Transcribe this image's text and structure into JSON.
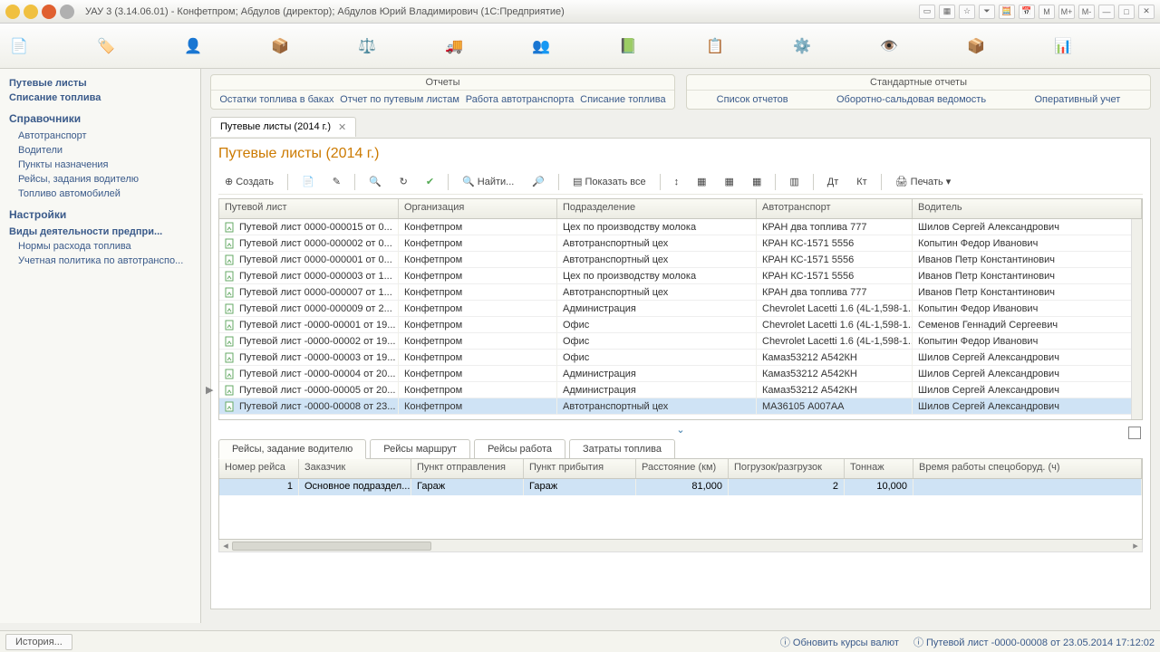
{
  "window": {
    "title": "УАУ 3 (3.14.06.01) - Конфетпром; Абдулов (директор); Абдулов Юрий Владимирович   (1С:Предприятие)"
  },
  "sidebar": {
    "group1_title": "Путевые листы",
    "items1": [
      "Путевые листы",
      "Списание топлива"
    ],
    "group2_title": "Справочники",
    "items2": [
      "Автотранспорт",
      "Водители",
      "Пункты назначения",
      "Рейсы, задания водителю",
      "Топливо автомобилей"
    ],
    "group3_title": "Настройки",
    "items3": [
      "Виды деятельности предпри...",
      "Нормы расхода топлива",
      "Учетная политика по автотранспо..."
    ]
  },
  "reports": {
    "left_title": "Отчеты",
    "left_links": [
      "Остатки топлива в баках",
      "Отчет по путевым листам",
      "Работа автотранспорта",
      "Списание топлива"
    ],
    "right_title": "Стандартные отчеты",
    "right_links": [
      "Список отчетов",
      "Оборотно-сальдовая ведомость",
      "Оперативный учет"
    ]
  },
  "tab": {
    "label": "Путевые листы (2014 г.)"
  },
  "page_title": "Путевые листы (2014 г.)",
  "toolbar": {
    "create": "Создать",
    "find": "Найти...",
    "show_all": "Показать все",
    "print": "Печать"
  },
  "grid": {
    "headers": [
      "Путевой лист",
      "Организация",
      "Подразделение",
      "Автотранспорт",
      "Водитель"
    ],
    "rows": [
      {
        "d": "Путевой лист 0000-000015 от 0...",
        "o": "Конфетпром",
        "p": "Цех по производству молока",
        "a": "КРАН два топлива 777",
        "v": "Шилов Сергей Александрович"
      },
      {
        "d": "Путевой лист 0000-000002 от 0...",
        "o": "Конфетпром",
        "p": "Автотранспортный цех",
        "a": "КРАН КС-1571 5556",
        "v": "Копытин Федор Иванович"
      },
      {
        "d": "Путевой лист 0000-000001 от 0...",
        "o": "Конфетпром",
        "p": "Автотранспортный цех",
        "a": "КРАН КС-1571 5556",
        "v": "Иванов  Петр  Константинович"
      },
      {
        "d": "Путевой лист 0000-000003 от 1...",
        "o": "Конфетпром",
        "p": "Цех по производству молока",
        "a": "КРАН КС-1571 5556",
        "v": "Иванов  Петр  Константинович"
      },
      {
        "d": "Путевой лист 0000-000007 от 1...",
        "o": "Конфетпром",
        "p": "Автотранспортный цех",
        "a": "КРАН два топлива 777",
        "v": "Иванов  Петр  Константинович"
      },
      {
        "d": "Путевой лист 0000-000009 от 2...",
        "o": "Конфетпром",
        "p": "Администрация",
        "a": "Chevrolet Lacetti 1.6 (4L-1,598-1...",
        "v": "Копытин Федор Иванович"
      },
      {
        "d": "Путевой лист -0000-00001 от 19...",
        "o": "Конфетпром",
        "p": "Офис",
        "a": "Chevrolet Lacetti 1.6 (4L-1,598-1...",
        "v": "Семенов Геннадий Сергеевич"
      },
      {
        "d": "Путевой лист -0000-00002 от 19...",
        "o": "Конфетпром",
        "p": "Офис",
        "a": "Chevrolet Lacetti 1.6 (4L-1,598-1...",
        "v": "Копытин Федор Иванович"
      },
      {
        "d": "Путевой лист -0000-00003 от 19...",
        "o": "Конфетпром",
        "p": "Офис",
        "a": "Камаз53212 А542КН",
        "v": "Шилов Сергей Александрович"
      },
      {
        "d": "Путевой лист -0000-00004 от 20...",
        "o": "Конфетпром",
        "p": "Администрация",
        "a": "Камаз53212 А542КН",
        "v": "Шилов Сергей Александрович"
      },
      {
        "d": "Путевой лист -0000-00005 от 20...",
        "o": "Конфетпром",
        "p": "Администрация",
        "a": "Камаз53212 А542КН",
        "v": "Шилов Сергей Александрович"
      },
      {
        "d": "Путевой лист -0000-00008 от 23...",
        "o": "Конфетпром",
        "p": "Автотранспортный цех",
        "a": "МА36105 А007АА",
        "v": "Шилов Сергей Александрович",
        "sel": true
      }
    ]
  },
  "detail_tabs": [
    "Рейсы, задание водителю",
    "Рейсы маршрут",
    "Рейсы работа",
    "Затраты топлива"
  ],
  "detail": {
    "headers": [
      "Номер рейса",
      "Заказчик",
      "Пункт отправления",
      "Пункт прибытия",
      "Расстояние (км)",
      "Погрузок/разгрузок",
      "Тоннаж",
      "Время работы спецоборуд. (ч)"
    ],
    "row": {
      "num": "1",
      "cust": "Основное подраздел...",
      "from": "Гараж",
      "to": "Гараж",
      "dist": "81,000",
      "load": "2",
      "ton": "10,000",
      "time": ""
    }
  },
  "status": {
    "history": "История...",
    "rate": "Обновить курсы валют",
    "info": "Путевой лист -0000-00008 от 23.05.2014 17:12:02"
  }
}
